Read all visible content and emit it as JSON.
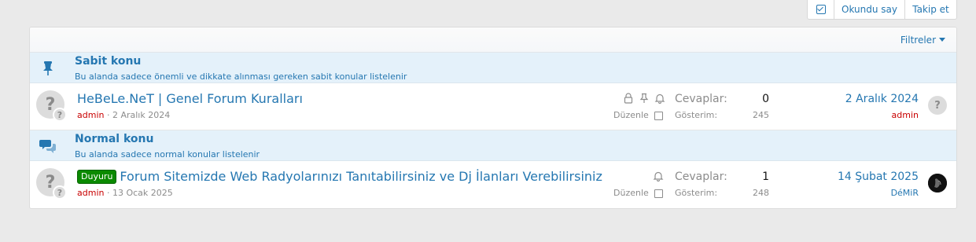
{
  "toolbar": {
    "mark_read_label": "Okundu say",
    "follow_label": "Takip et"
  },
  "filters": {
    "label": "Filtreler"
  },
  "sticky_section": {
    "title": "Sabit konu",
    "description": "Bu alanda sadece önemli ve dikkate alınması gereken sabit konular listelenir"
  },
  "normal_section": {
    "title": "Normal konu",
    "description": "Bu alanda sadece normal konular listelenir"
  },
  "threads": [
    {
      "avatar_glyph": "?",
      "prefix": "",
      "title": "HeBeLe.NeT | Genel Forum Kuralları",
      "author": "admin",
      "separator": "·",
      "start_date": "2 Aralık 2024",
      "replies_label": "Cevaplar:",
      "replies": "0",
      "views_label": "Gösterim:",
      "views": "245",
      "edit_label": "Düzenle",
      "last_date": "2 Aralık 2024",
      "last_user": "admin",
      "last_user_color": "#c80000",
      "last_avatar_glyph": "?"
    },
    {
      "avatar_glyph": "?",
      "prefix": "Duyuru",
      "title": "Forum Sitemizde Web Radyolarınızı Tanıtabilirsiniz ve Dj İlanları Verebilirsiniz",
      "author": "admin",
      "separator": "·",
      "start_date": "13 Ocak 2025",
      "replies_label": "Cevaplar:",
      "replies": "1",
      "views_label": "Gösterim:",
      "views": "248",
      "edit_label": "Düzenle",
      "last_date": "14 Şubat 2025",
      "last_user": "DéMiR",
      "last_user_color": "#2577b1",
      "last_avatar_glyph": ""
    }
  ],
  "colors": {
    "accent": "#2577b1",
    "section_bg": "#e4f1fa",
    "username_red": "#c80000",
    "prefix_green": "#0b8a00"
  },
  "icons": {
    "top_check": "checkbox-check-icon",
    "sticky": "thumbtack-icon",
    "normal": "comments-icon",
    "locked": "lock-icon",
    "sticky_status": "pin-icon",
    "watch": "bell-icon"
  }
}
